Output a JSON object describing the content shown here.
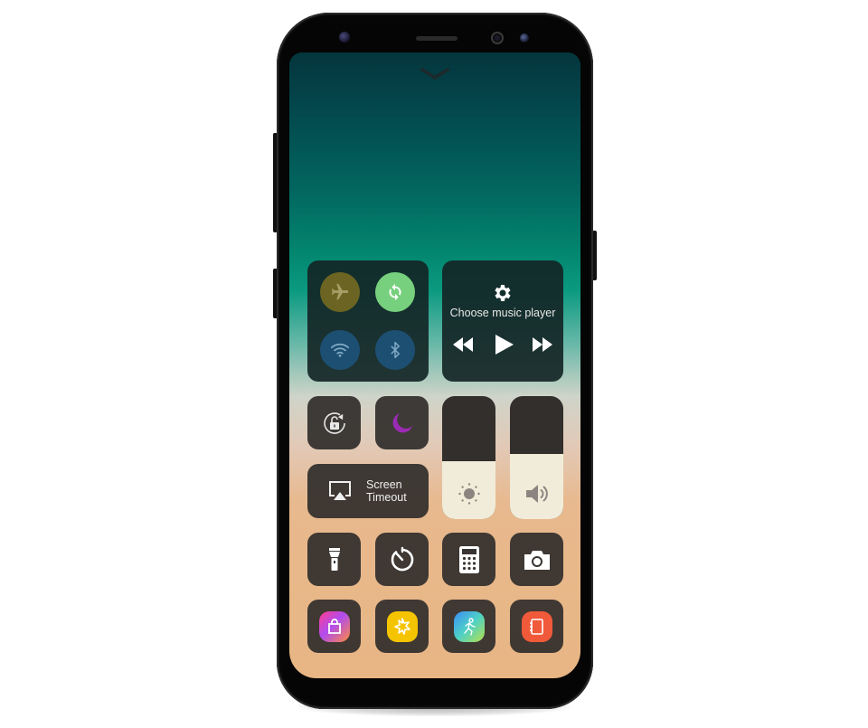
{
  "device": {
    "type": "smartphone",
    "screen": "control-center"
  },
  "top": {
    "dismiss_icon": "chevron-down-icon"
  },
  "connectivity": {
    "items": [
      {
        "name": "airplane-mode",
        "icon": "airplane-icon",
        "state": "off",
        "color": "#6c6422"
      },
      {
        "name": "auto-sync",
        "icon": "sync-icon",
        "state": "on",
        "color": "#77d07e"
      },
      {
        "name": "wifi",
        "icon": "wifi-icon",
        "state": "off",
        "color": "#1d4f72"
      },
      {
        "name": "bluetooth",
        "icon": "bluetooth-icon",
        "state": "off",
        "color": "#1d4f72"
      }
    ]
  },
  "music": {
    "settings_icon": "gear-icon",
    "label": "Choose music player",
    "controls": [
      "rewind",
      "play",
      "fast-forward"
    ]
  },
  "toggles": {
    "rotation_lock_icon": "rotation-lock-icon",
    "do_not_disturb_icon": "moon-icon",
    "moon_color": "#9b2bb5"
  },
  "screen_timeout": {
    "icon": "airplay-icon",
    "label_line1": "Screen",
    "label_line2": "Timeout"
  },
  "sliders": {
    "brightness": {
      "icon": "sun-icon",
      "level_percent": 47
    },
    "volume": {
      "icon": "speaker-icon",
      "level_percent": 53
    }
  },
  "shortcuts": [
    {
      "name": "flashlight",
      "icon": "flashlight-icon"
    },
    {
      "name": "timer",
      "icon": "timer-icon"
    },
    {
      "name": "calculator",
      "icon": "calculator-icon"
    },
    {
      "name": "camera",
      "icon": "camera-icon"
    }
  ],
  "apps": [
    {
      "name": "galaxy-store",
      "icon": "shopping-bag-icon"
    },
    {
      "name": "bixby-home",
      "icon": "flower-icon"
    },
    {
      "name": "samsung-health",
      "icon": "runner-icon"
    },
    {
      "name": "samsung-notes",
      "icon": "notebook-icon"
    }
  ]
}
